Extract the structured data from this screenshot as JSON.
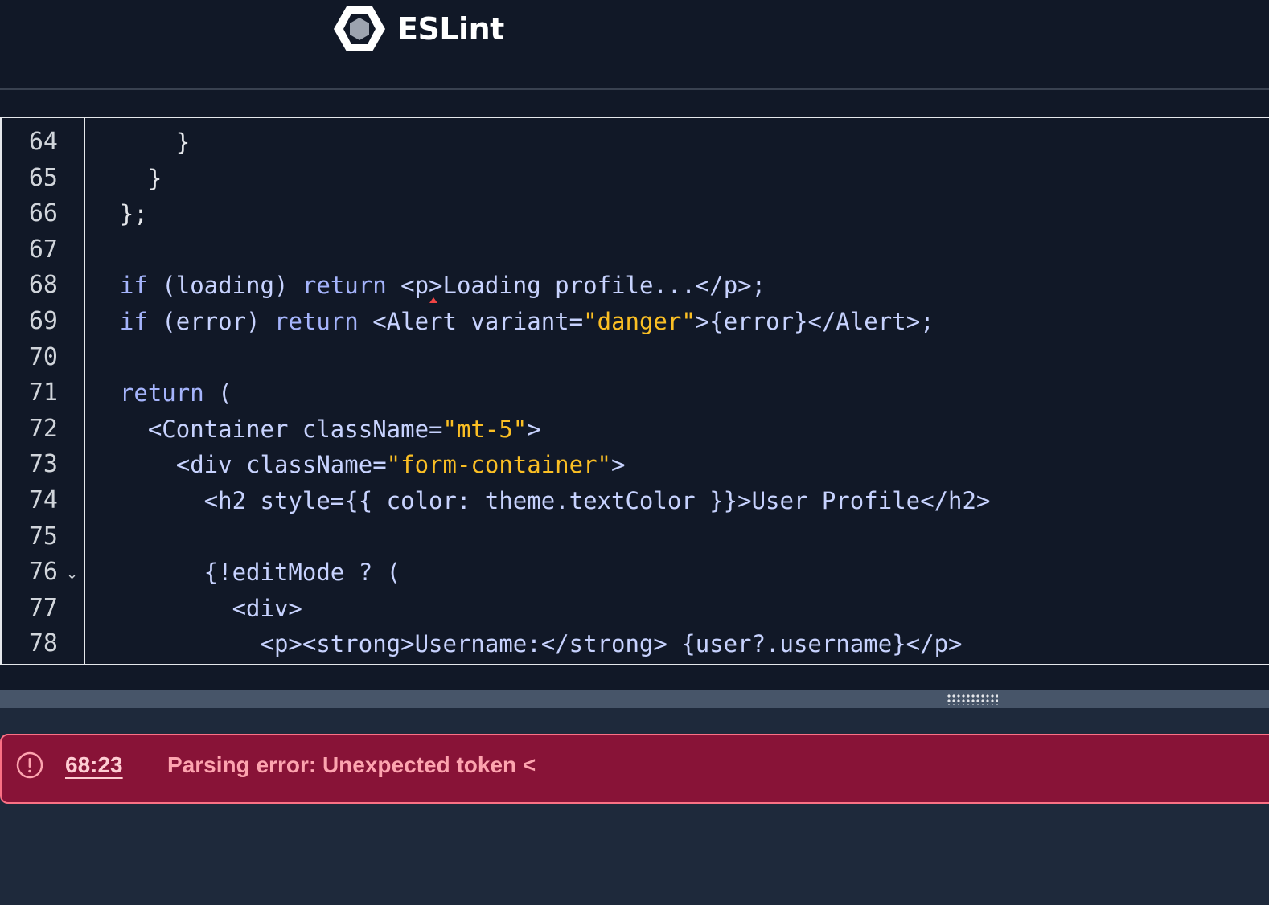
{
  "header": {
    "brand": "ESLint"
  },
  "editor": {
    "lines": [
      {
        "num": "64",
        "segments": [
          {
            "t": "      }",
            "c": "punct"
          }
        ]
      },
      {
        "num": "65",
        "segments": [
          {
            "t": "    }",
            "c": "punct"
          }
        ]
      },
      {
        "num": "66",
        "segments": [
          {
            "t": "  };",
            "c": "punct"
          }
        ]
      },
      {
        "num": "67",
        "segments": []
      },
      {
        "num": "68",
        "segments": [
          {
            "t": "  if",
            "c": "kw"
          },
          {
            "t": " (loading) ",
            "c": "code"
          },
          {
            "t": "return",
            "c": "kw"
          },
          {
            "t": " <p>Loading profile...</p>;",
            "c": "code"
          }
        ]
      },
      {
        "num": "69",
        "segments": [
          {
            "t": "  if",
            "c": "kw"
          },
          {
            "t": " (error) ",
            "c": "code"
          },
          {
            "t": "return",
            "c": "kw"
          },
          {
            "t": " <Alert variant=",
            "c": "code"
          },
          {
            "t": "\"danger\"",
            "c": "str"
          },
          {
            "t": ">{error}</Alert>;",
            "c": "code"
          }
        ]
      },
      {
        "num": "70",
        "segments": []
      },
      {
        "num": "71",
        "segments": [
          {
            "t": "  return",
            "c": "kw"
          },
          {
            "t": " (",
            "c": "code"
          }
        ]
      },
      {
        "num": "72",
        "segments": [
          {
            "t": "    <Container className=",
            "c": "code"
          },
          {
            "t": "\"mt-5\"",
            "c": "str"
          },
          {
            "t": ">",
            "c": "code"
          }
        ]
      },
      {
        "num": "73",
        "segments": [
          {
            "t": "      <div className=",
            "c": "code"
          },
          {
            "t": "\"form-container\"",
            "c": "str"
          },
          {
            "t": ">",
            "c": "code"
          }
        ]
      },
      {
        "num": "74",
        "segments": [
          {
            "t": "        <h2 style={{ color: theme.textColor }}>User Profile</h2>",
            "c": "code"
          }
        ]
      },
      {
        "num": "75",
        "segments": []
      },
      {
        "num": "76",
        "fold": true,
        "segments": [
          {
            "t": "        {!editMode ? (",
            "c": "code"
          }
        ]
      },
      {
        "num": "77",
        "segments": [
          {
            "t": "          <div>",
            "c": "code"
          }
        ]
      },
      {
        "num": "78",
        "segments": [
          {
            "t": "            <p><strong>Username:</strong> {user?.username}</p>",
            "c": "code"
          }
        ]
      }
    ],
    "fold_icon": "chevron-down-icon"
  },
  "error": {
    "icon": "alert-circle-icon",
    "location": "68:23",
    "message": "Parsing error: Unexpected token <"
  },
  "colors": {
    "background": "#111827",
    "keyword": "#a5b4fc",
    "string": "#fbbf24",
    "error_bg": "#881337",
    "error_text": "#fda4af"
  }
}
